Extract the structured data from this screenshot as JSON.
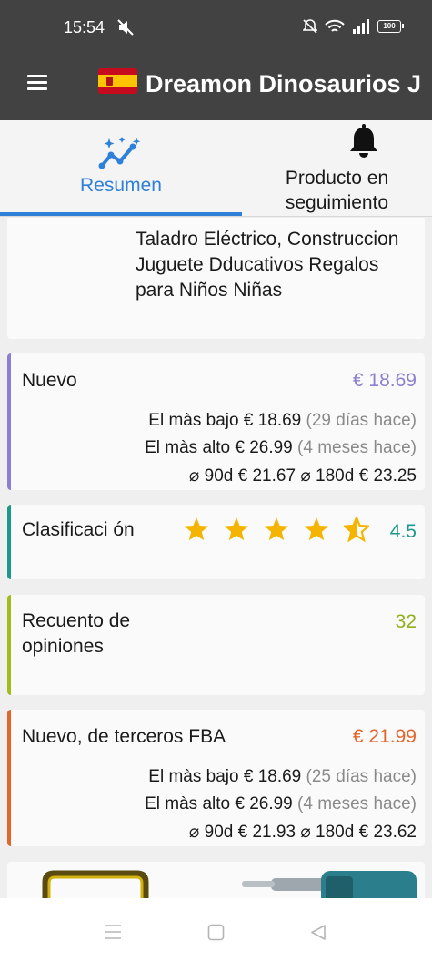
{
  "status_bar": {
    "time": "15:54",
    "battery": "100",
    "icons": [
      "mute-icon",
      "bell-off-icon",
      "wifi-icon",
      "signal-icon",
      "battery-icon"
    ]
  },
  "app_bar": {
    "flag": "spain-flag-icon",
    "title": "Dreamon Dinosaurios J"
  },
  "tabs": [
    {
      "label": "Resumen",
      "icon": "chart-sparkle-icon",
      "active": true
    },
    {
      "label": "Producto en seguimiento",
      "icon": "bell-icon",
      "active": false
    }
  ],
  "product": {
    "title": "Taladro Eléctrico, Construccion Juguete Dducativos Regalos para Niños Niñas"
  },
  "price_new": {
    "label": "Nuevo",
    "price": "€ 18.69",
    "low_label": "El màs bajo",
    "low_price": "€ 18.69",
    "low_when": "(29 días hace)",
    "high_label": "El màs alto",
    "high_price": "€ 26.99",
    "high_when": "(4 meses hace)",
    "avg90_label": "⌀ 90d",
    "avg90": "€ 21.67",
    "avg180_label": "⌀ 180d",
    "avg180": "€ 23.25",
    "accent": "#8b7fd1"
  },
  "rating": {
    "label": "Clasificaci ón",
    "value": "4.5",
    "stars": 4.5,
    "accent": "#1a9a8a",
    "star_color": "#f5b400"
  },
  "reviews": {
    "label": "Recuento de opiniones",
    "value": "32",
    "accent": "#a2bc1c"
  },
  "price_fba": {
    "label": "Nuevo, de terceros FBA",
    "price": "€ 21.99",
    "low_label": "El màs bajo",
    "low_price": "€ 18.69",
    "low_when": "(25 días hace)",
    "high_label": "El màs alto",
    "high_price": "€ 26.99",
    "high_when": "(4 meses hace)",
    "avg90_label": "⌀ 90d",
    "avg90": "€ 21.93",
    "avg180_label": "⌀ 180d",
    "avg180": "€ 23.62",
    "accent": "#e2652c"
  },
  "nav_bar": {
    "icons": [
      "recents-icon",
      "home-icon",
      "back-icon"
    ]
  }
}
